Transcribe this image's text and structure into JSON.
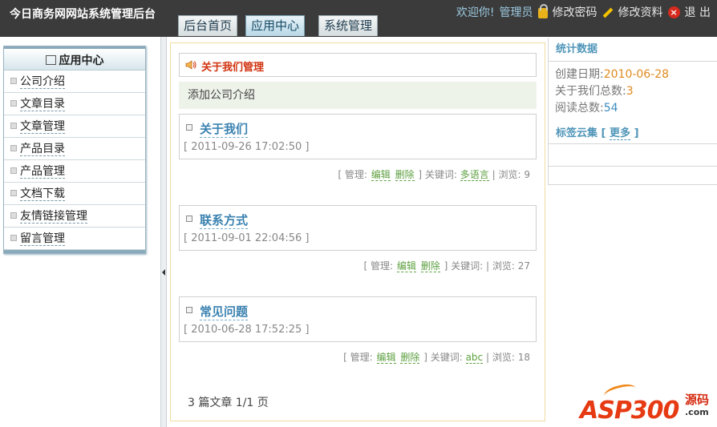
{
  "header": {
    "site_title": "今日商务网网站系统管理后台",
    "nav_tabs": [
      {
        "label": "后台首页",
        "active": false
      },
      {
        "label": "应用中心",
        "active": true
      },
      {
        "label": "系统管理",
        "active": false
      }
    ],
    "welcome": "欢迎你!",
    "username": "管理员",
    "change_password": "修改密码",
    "edit_profile": "修改资料",
    "logout": "退 出"
  },
  "sidebar": {
    "title": "应用中心",
    "items": [
      {
        "label": "公司介绍"
      },
      {
        "label": "文章目录"
      },
      {
        "label": "文章管理"
      },
      {
        "label": "产品目录"
      },
      {
        "label": "产品管理"
      },
      {
        "label": "文档下载"
      },
      {
        "label": "友情链接管理"
      },
      {
        "label": "留言管理"
      }
    ]
  },
  "main": {
    "title": "关于我们管理",
    "add_link": "添加公司介绍",
    "meta_labels": {
      "open": "[",
      "manage": "管理:",
      "edit": "编辑",
      "delete": "删除",
      "keywords": "] 关键词:",
      "views": "| 浏览:"
    },
    "articles": [
      {
        "title": "关于我们",
        "date": "[ 2011-09-26 17:02:50 ]",
        "keyword": "多语言",
        "views": "9"
      },
      {
        "title": "联系方式",
        "date": "[ 2011-09-01 22:04:56 ]",
        "keyword": "",
        "views": "27"
      },
      {
        "title": "常见问题",
        "date": "[ 2010-06-28 17:52:25 ]",
        "keyword": "abc",
        "views": "18"
      }
    ],
    "pager": "3 篇文章  1/1 页"
  },
  "stats": {
    "title": "统计数据",
    "created_label": "创建日期:",
    "created_value": "2010-06-28",
    "total_label": "关于我们总数:",
    "total_value": "3",
    "views_label": "阅读总数:",
    "views_value": "54"
  },
  "tags": {
    "title": "标签云集",
    "more_open": "[",
    "more": "更多",
    "more_close": "]"
  },
  "watermark": {
    "brand": "ASP300",
    "suffix": "源码",
    "domain": ".com"
  },
  "colors": {
    "header_bg": "#3b3b3b",
    "link_blue": "#3b82b0",
    "action_green": "#5ea041",
    "title_red": "#d1330f"
  }
}
